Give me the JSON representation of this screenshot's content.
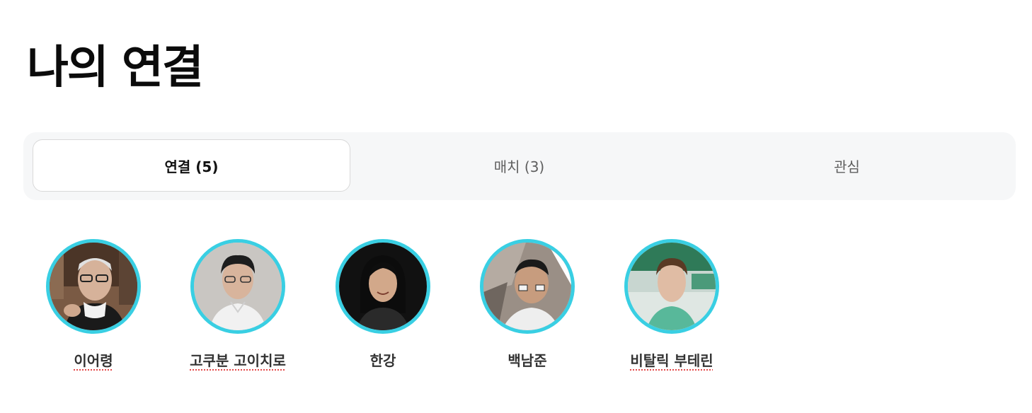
{
  "page": {
    "title": "나의 연결"
  },
  "tabs": [
    {
      "label": "연결 (5)",
      "active": true
    },
    {
      "label": "매치 (3)",
      "active": false
    },
    {
      "label": "관심",
      "active": false
    }
  ],
  "connections": [
    {
      "name": "이어령",
      "spellcheck_underline": true
    },
    {
      "name": "고쿠분 고이치로",
      "spellcheck_underline": true
    },
    {
      "name": "한강",
      "spellcheck_underline": false
    },
    {
      "name": "백남준",
      "spellcheck_underline": false
    },
    {
      "name": "비탈릭 부테린",
      "spellcheck_underline": true
    }
  ],
  "colors": {
    "avatar_ring": "#39cfe3",
    "spellcheck_underline": "#e34848",
    "tabbar_background": "#f6f7f8"
  }
}
